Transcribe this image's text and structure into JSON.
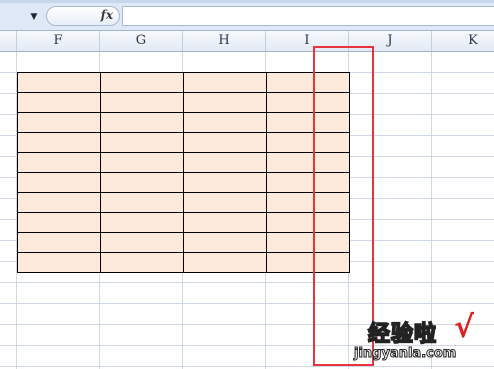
{
  "formula_bar": {
    "namebox_value": "",
    "dropdown_glyph": "▼",
    "fx_label": "fx",
    "formula_value": ""
  },
  "columns": [
    "F",
    "G",
    "H",
    "I",
    "J",
    "K"
  ],
  "table": {
    "rows": 10,
    "cols": 4,
    "fill_color": "#fde9d9",
    "border_color": "#000000",
    "cells": [
      [
        "",
        "",
        "",
        ""
      ],
      [
        "",
        "",
        "",
        ""
      ],
      [
        "",
        "",
        "",
        ""
      ],
      [
        "",
        "",
        "",
        ""
      ],
      [
        "",
        "",
        "",
        ""
      ],
      [
        "",
        "",
        "",
        ""
      ],
      [
        "",
        "",
        "",
        ""
      ],
      [
        "",
        "",
        "",
        ""
      ],
      [
        "",
        "",
        "",
        ""
      ],
      [
        "",
        "",
        "",
        ""
      ]
    ]
  },
  "highlight": {
    "color": "#e8353d",
    "target_column": "I"
  },
  "watermark": {
    "title": "经验啦",
    "check": "√",
    "url": "jingyanla.com"
  }
}
